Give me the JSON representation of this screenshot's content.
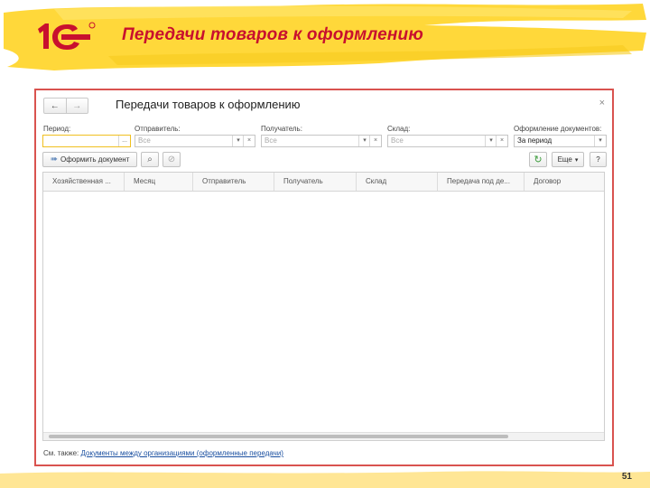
{
  "slide": {
    "title": "Передачи товаров к оформлению",
    "page_number": "51",
    "colors": {
      "banner": "#ffd83a",
      "title": "#c8102e",
      "frame": "#d9534f"
    }
  },
  "window": {
    "nav": {
      "back_icon": "arrow-left-icon",
      "forward_icon": "arrow-right-icon"
    },
    "title": "Передачи товаров к оформлению",
    "close": "×",
    "filters": {
      "period": {
        "label": "Период:",
        "value": "",
        "button": "..."
      },
      "sender": {
        "label": "Отправитель:",
        "placeholder": "Все"
      },
      "recipient": {
        "label": "Получатель:",
        "placeholder": "Все"
      },
      "warehouse": {
        "label": "Склад:",
        "placeholder": "Все"
      },
      "doc_status": {
        "label": "Оформление документов:",
        "value": "За период"
      }
    },
    "toolbar": {
      "create_doc": "Оформить документ",
      "more": "Еще",
      "help": "?"
    },
    "table": {
      "columns": [
        "Хозяйственная ...",
        "Месяц",
        "Отправитель",
        "Получатель",
        "Склад",
        "Передача под де...",
        "Договор"
      ]
    },
    "see_also": {
      "prefix": "См. также:",
      "link": "Документы между организациями (оформленные передачи)"
    }
  }
}
